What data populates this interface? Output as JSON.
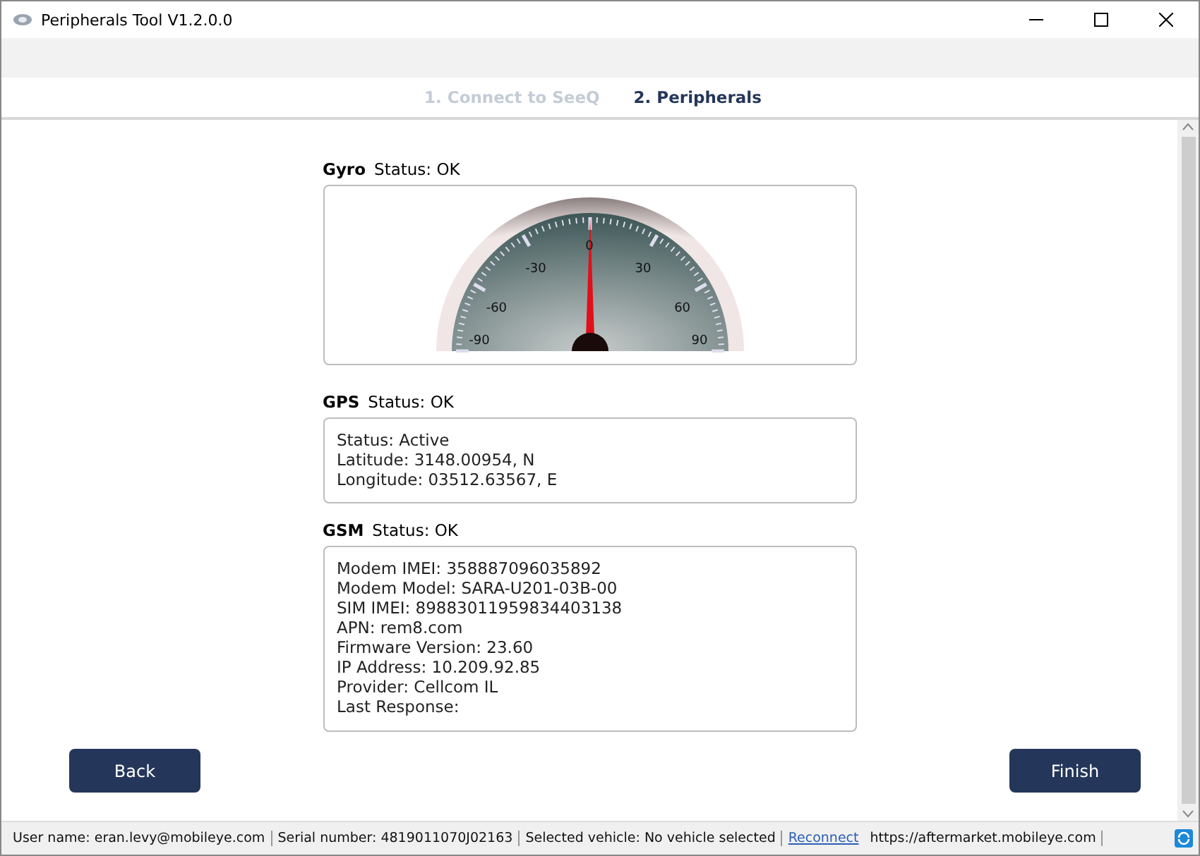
{
  "window": {
    "title": "Peripherals Tool V1.2.0.0"
  },
  "steps": [
    {
      "label": "1. Connect to SeeQ",
      "selected": false
    },
    {
      "label": "2. Peripherals",
      "selected": true
    }
  ],
  "gyro": {
    "name": "Gyro",
    "status": "Status: OK",
    "gauge": {
      "scale": [
        "-90",
        "-60",
        "-30",
        "0",
        "30",
        "60",
        "90"
      ],
      "level": 0.5
    }
  },
  "gps": {
    "name": "GPS",
    "status": "Status: OK",
    "lines": [
      "Status: Active",
      "Latitude: 3148.00954, N",
      "Longitude: 03512.63567, E"
    ]
  },
  "gsm": {
    "name": "GSM",
    "status": "Status: OK",
    "lines": [
      "Modem IMEI: 358887096035892",
      "Modem Model: SARA-U201-03B-00",
      "SIM IMEI: 89883011959834403138",
      "APN: rem8.com",
      "Firmware Version: 23.60",
      "IP Address: 10.209.92.85",
      "Provider: Cellcom IL",
      "Last Response:"
    ]
  },
  "buttons": {
    "back": "Back",
    "finish": "Finish"
  },
  "status_bar": [
    {
      "kind": "text",
      "label": "User name:",
      "value": "eran.levy@mobileye.com"
    },
    {
      "kind": "text",
      "label": "Serial number:",
      "value": "4819011070J02163"
    },
    {
      "kind": "text",
      "label": "Selected vehicle:",
      "value": "No vehicle selected"
    },
    {
      "kind": "link",
      "value": "Reconnect"
    },
    {
      "kind": "text",
      "value": "https://aftermarket.mobileye.com"
    }
  ]
}
